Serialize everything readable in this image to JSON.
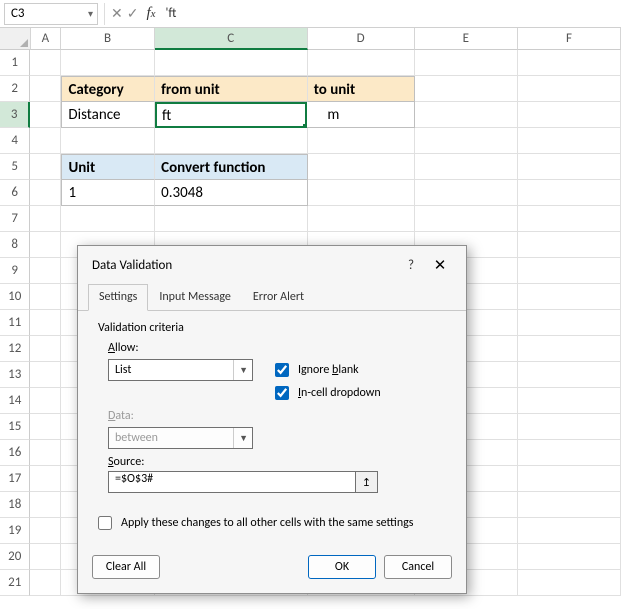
{
  "formula_bar": {
    "namebox": "C3",
    "formula": "'ft"
  },
  "columns": [
    "A",
    "B",
    "C",
    "D",
    "E",
    "F"
  ],
  "rows_count": 21,
  "selected_cell": "C3",
  "sheet": {
    "B2": "Category",
    "C2": "from unit",
    "D2": "to unit",
    "B3": "Distance",
    "C3": "ft",
    "D3": "m",
    "B5": "Unit",
    "C5": "Convert function",
    "B6": "1",
    "C6": "0.3048"
  },
  "dialog": {
    "title": "Data Validation",
    "tabs": [
      "Settings",
      "Input Message",
      "Error Alert"
    ],
    "active_tab": 0,
    "criteria_label": "Validation criteria",
    "allow_label": "Allow:",
    "allow_value": "List",
    "ignore_blank_label": "Ignore blank",
    "ignore_blank": true,
    "incell_label": "In-cell dropdown",
    "incell": true,
    "data_label": "Data:",
    "data_value": "between",
    "source_label": "Source:",
    "source_value": "=$O$3#",
    "apply_label": "Apply these changes to all other cells with the same settings",
    "apply": false,
    "clear_all": "Clear All",
    "ok": "OK",
    "cancel": "Cancel"
  }
}
